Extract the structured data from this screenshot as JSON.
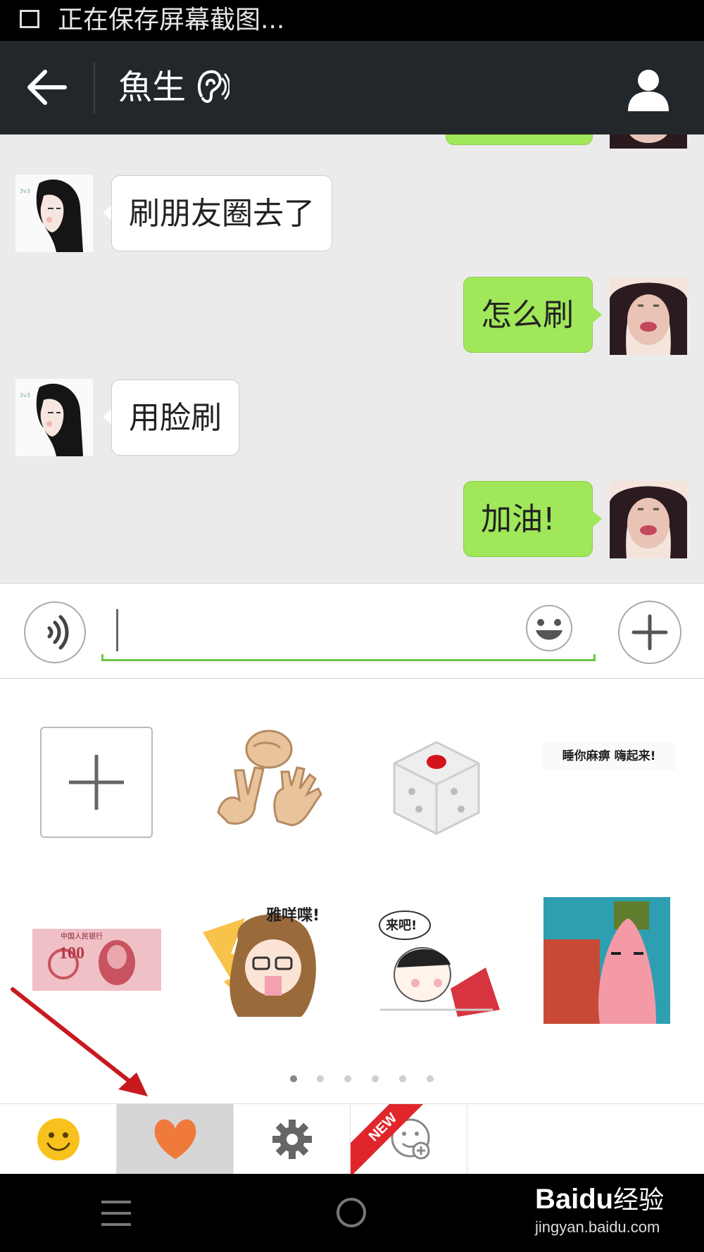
{
  "status_bar": {
    "text": "正在保存屏幕截图..."
  },
  "header": {
    "title": "魚生"
  },
  "messages": [
    {
      "side": "left",
      "text": "刷朋友圈去了"
    },
    {
      "side": "right",
      "text": "怎么刷"
    },
    {
      "side": "left",
      "text": "用脸刷"
    },
    {
      "side": "right",
      "text": "加油!"
    }
  ],
  "input": {
    "value": "",
    "placeholder": ""
  },
  "stickers": {
    "sleep_text": "睡你麻痹  嗨起来!",
    "yamie_text": "雅咩喋!",
    "laiba_text": "来吧!",
    "banknote_value": "100",
    "banknote_bank": "中国人民银行"
  },
  "pager": {
    "pages": 6,
    "current": 0
  },
  "tabs": [
    {
      "icon": "smiley-icon"
    },
    {
      "icon": "heart-icon",
      "active": true
    },
    {
      "icon": "gear-icon"
    },
    {
      "icon": "add-sticker-icon",
      "badge": "NEW"
    }
  ],
  "watermark": {
    "brand": "Baidu",
    "brand_cn": "经验",
    "url": "jingyan.baidu.com"
  },
  "colors": {
    "header_bg": "#22272b",
    "bubble_right": "#a0e759",
    "bubble_left": "#ffffff",
    "accent_green": "#6cc644",
    "heart": "#f07a3c",
    "new_badge": "#e0262b"
  }
}
